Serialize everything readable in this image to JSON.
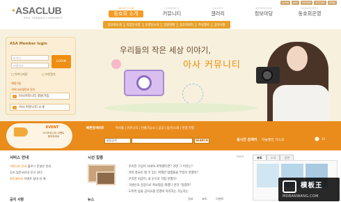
{
  "header": {
    "logo": "ASACLUB",
    "tagline": "REAL FRIENDLY COMMUNITY",
    "util_links": [
      "LOGIN",
      "JOIN",
      "SITEMAP",
      "ATTOMA",
      "FRINE"
    ],
    "nav": [
      {
        "sub": "ABOUT CLUB",
        "label": "동호회 소개",
        "active": true
      },
      {
        "sub": "COMMUNITY",
        "label": "커뮤니티",
        "active": false
      },
      {
        "sub": "GALLERY",
        "label": "갤러리",
        "active": false
      },
      {
        "sub": "INFORMATION",
        "label": "정보마당",
        "active": false
      },
      {
        "sub": "MANAGEMENT",
        "label": "동호회운영",
        "active": false
      }
    ],
    "subnav": [
      "동호회소개",
      "회장인사말",
      "운영진소개",
      "임원현황",
      "동호회회칙",
      "주요행사",
      "공지사항"
    ]
  },
  "login": {
    "title": "ASA Member login",
    "id_placeholder": "아이디",
    "pw_placeholder": "비밀번호",
    "login_button": "LOGIN",
    "save_id": "아이디저장",
    "secure": "보안접속",
    "join_link": "회원가입",
    "find_link": "아이디/비밀번호 찾기",
    "btn_join": "아사커뮤니티 회원가입",
    "btn_about": "아사 커뮤니티 소개"
  },
  "hero": {
    "slogan_line1": "우리들의 작은 세상 이야기,",
    "slogan_line2": "아사 커뮤니티"
  },
  "event": {
    "title": "EVENT",
    "text": "아사커뮤니티 이벤트 응모하세요"
  },
  "quick": {
    "title": "빠른검색바로",
    "links": "여사룰 | 커뮤니티 | 빈출가능소 | 공공 | 동신/스레 | 반결 천결",
    "search_select": "통합검색",
    "search_button": "SEARCH",
    "rank_label": "실시간 검색어",
    "rank_value": "하늘절친 가스코",
    "rank_delta": "15"
  },
  "service": {
    "title": "서비스 안내",
    "lines": [
      {
        "hl": "커뮤니티 안내",
        "text": "블로그 운영안 안내"
      },
      {
        "hl": "",
        "text": "공지 및문서안내 후기 UCC"
      },
      {
        "hl": "포토갤러리",
        "text": "이벤트 참여 안 해"
      }
    ],
    "notice_title": "공지 사항"
  },
  "news": {
    "title": "시선 집중",
    "more": "more",
    "items": [
      "· 우리만 가심어 100% 바위했다면? 과연 그 이유는?",
      "· 카련 흥요로 잘 수 있는 위해연 밥캠물을 부었지 못했지?",
      "· 우리만 비상이, 내 순으로 직접 현행자!",
      "· 거센신의 김장으로 특보많음 해결다 연하 \"정결복\"",
      "· 도착적 동물 공지소를 한결비 처리하는 가능하는"
    ],
    "tabs_title": "뉴스",
    "tabs": [
      "정보",
      "포토",
      "이벤트"
    ]
  },
  "right": {
    "tabs": [
      "포토",
      "소식",
      "공연"
    ]
  },
  "watermark": {
    "title": "模板王",
    "url": "MOBANWANG.COM"
  }
}
